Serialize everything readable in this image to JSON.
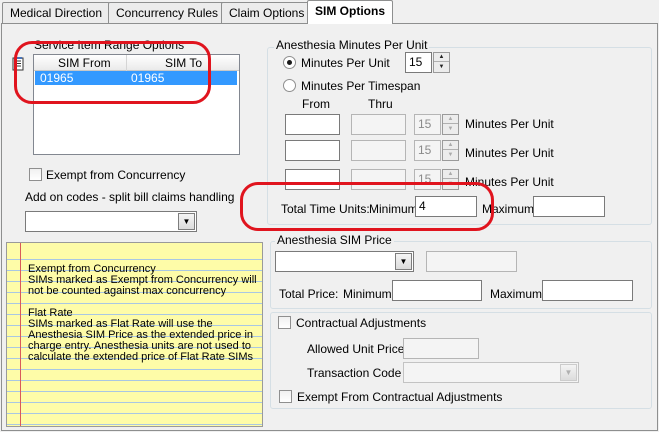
{
  "tabs": [
    {
      "label": "Medical Direction",
      "active": false
    },
    {
      "label": "Concurrency Rules",
      "active": false
    },
    {
      "label": "Claim Options",
      "active": false
    },
    {
      "label": "SIM Options",
      "active": true
    }
  ],
  "service_item_range": {
    "title": "Service Item Range Options",
    "columns": [
      "SIM From",
      "SIM To"
    ],
    "rows": [
      [
        "01965",
        "01965"
      ]
    ]
  },
  "exempt_from_concurrency": {
    "label": "Exempt from Concurrency",
    "checked": false
  },
  "add_on_codes": {
    "label": "Add on codes - split bill claims handling",
    "selected": ""
  },
  "notes": {
    "text": "Exempt from Concurrency\nSIMs marked as Exempt from Concurrency will not be counted against max concurrency\n\nFlat Rate\nSIMs marked as Flat Rate will use the Anesthesia SIM Price as the extended price in charge entry. Anesthesia units are not used to calculate the extended price of Flat Rate SIMs"
  },
  "anesthesia_minutes": {
    "title": "Anesthesia Minutes Per Unit",
    "minutes_per_unit_label": "Minutes Per Unit",
    "minutes_per_unit_value": "15",
    "minutes_per_timespan_label": "Minutes Per Timespan",
    "from_label": "From",
    "thru_label": "Thru",
    "timespan_rows": [
      {
        "from": "",
        "thru": "",
        "minutes": "15",
        "suffix": "Minutes Per Unit"
      },
      {
        "from": "",
        "thru": "",
        "minutes": "15",
        "suffix": "Minutes Per Unit"
      },
      {
        "from": "",
        "thru": "",
        "minutes": "15",
        "suffix": "Minutes Per Unit"
      }
    ],
    "total_time_units_label": "Total Time Units:",
    "minimum_label": "Minimum",
    "minimum_value": "4",
    "maximum_label": "Maximum",
    "maximum_value": ""
  },
  "sim_price": {
    "title": "Anesthesia SIM Price",
    "selected": "",
    "price_value": "",
    "total_price_label": "Total Price:",
    "minimum_label": "Minimum",
    "minimum_value": "",
    "maximum_label": "Maximum",
    "maximum_value": ""
  },
  "contractual": {
    "label": "Contractual Adjustments",
    "checked": false,
    "allowed_unit_price_label": "Allowed Unit Price",
    "allowed_unit_price_value": "",
    "transaction_code_label": "Transaction Code",
    "transaction_code_value": "",
    "exempt_label": "Exempt From Contractual Adjustments",
    "exempt_checked": false
  },
  "colors": {
    "highlight_oval": "#e0141e",
    "selected_row": "#3399ff",
    "notepad": "#fefca8"
  }
}
